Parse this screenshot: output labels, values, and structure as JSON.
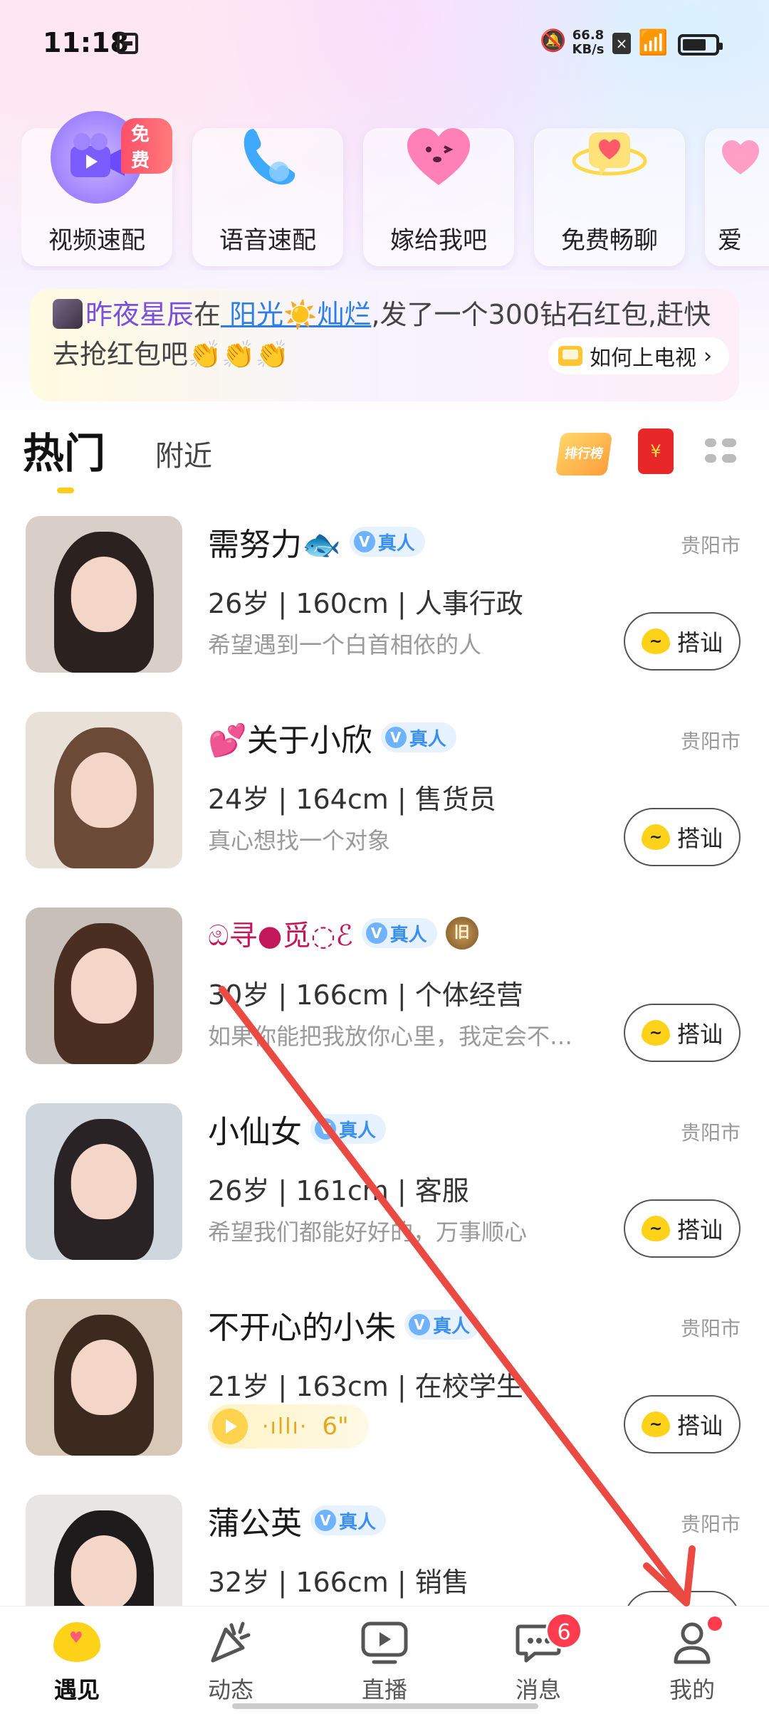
{
  "status_bar": {
    "time": "11:18",
    "net_speed_value": "66.8",
    "net_speed_unit": "KB/s",
    "icons": [
      "calendar-icon",
      "mute-icon",
      "x-box-icon",
      "wifi-icon",
      "battery-icon"
    ]
  },
  "quick_actions": [
    {
      "label": "视频速配",
      "icon": "video-camera-icon",
      "badge": "免费",
      "color": "#a98bff"
    },
    {
      "label": "语音速配",
      "icon": "phone-icon",
      "color": "#4fb6ff"
    },
    {
      "label": "嫁给我吧",
      "icon": "heart-face-icon",
      "color": "#ff7fb6"
    },
    {
      "label": "免费畅聊",
      "icon": "chat-heart-icon",
      "color": "#ffd84a"
    },
    {
      "label": "爱",
      "icon": "heart-icon",
      "color": "#ff9fc5"
    }
  ],
  "banner": {
    "user": "昨夜星辰",
    "in_text": "在",
    "room": " 阳光☀️灿烂",
    "message": ",发了一个300钻石红包,赶快",
    "line2": "去抢红包吧👏👏👏",
    "howto": "如何上电视",
    "howto_arrow": "›"
  },
  "tabs": {
    "hot": "热门",
    "nearby": "附近",
    "rank_label": "排行榜",
    "redpack_symbol": "¥"
  },
  "verified_label": "真人",
  "chat_label": "搭讪",
  "users": [
    {
      "name": "需努力",
      "name_suffix": "🐟",
      "info": "26岁 | 160cm | 人事行政",
      "bio": "希望遇到一个白首相依的人",
      "city": "贵阳市",
      "bg": "#d9cfc8",
      "hair": "#2b2220"
    },
    {
      "name_prefix": "💕",
      "name": "关于小欣",
      "info": "24岁 | 164cm | 售货员",
      "bio": "真心想找一个对象",
      "city": "贵阳市",
      "bg": "#e9e1d8",
      "hair": "#6b4a38"
    },
    {
      "name": "ඔ寻●觅◌ℰ",
      "info": "30岁 | 166cm | 个体经营",
      "bio": "如果你能把我放你心里，我定会不…",
      "city": "",
      "rank_badge": "旧",
      "bg": "#c8bfb8",
      "hair": "#4a2e22"
    },
    {
      "name": "小仙女",
      "info": "26岁 | 161cm | 客服",
      "bio": "希望我们都能好好的，万事顺心",
      "city": "贵阳市",
      "bg": "#cfd6de",
      "hair": "#2a2326"
    },
    {
      "name": "不开心的小朱",
      "info": "21岁 | 163cm | 在校学生",
      "voice_duration": "6\"",
      "voice_wave": "·ıllı·",
      "city": "贵阳市",
      "bg": "#d8c8b8",
      "hair": "#3d2a1f"
    },
    {
      "name": "蒲公英",
      "info": "32岁 | 166cm | 销售",
      "bio": "",
      "city": "贵阳市",
      "bg": "#e8e6e4",
      "hair": "#1d1b1b"
    }
  ],
  "bottom_nav": [
    {
      "label": "遇见",
      "icon": "heart-home-icon",
      "active": true
    },
    {
      "label": "动态",
      "icon": "party-popper-icon"
    },
    {
      "label": "直播",
      "icon": "live-tv-icon"
    },
    {
      "label": "消息",
      "icon": "chat-bubble-icon",
      "badge": "6"
    },
    {
      "label": "我的",
      "icon": "person-icon",
      "dot": true
    }
  ],
  "accent_colors": {
    "yellow": "#ffd21a",
    "badge_red": "#ff3b4e",
    "verified_blue": "#3a8ff0",
    "annotation_red": "#ea4a42"
  }
}
